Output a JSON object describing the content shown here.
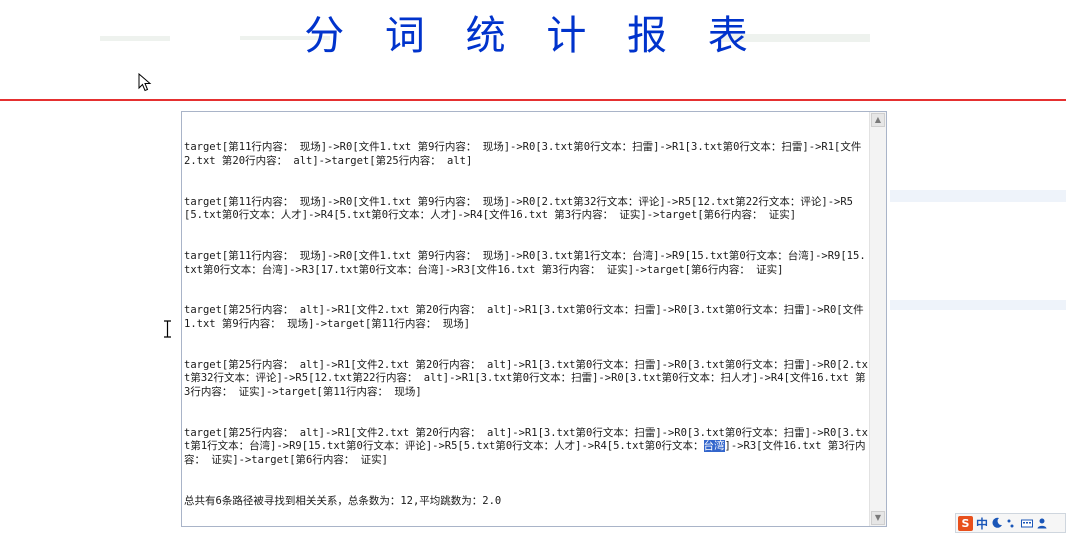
{
  "page": {
    "title": "分 词 统 计 报 表"
  },
  "colors": {
    "title": "#0033cc",
    "divider": "#e53030",
    "textarea_border": "#a9b4c8",
    "selection": "#3366cc"
  },
  "report": {
    "lines": [
      "target[第11行内容： 现场]->R0[文件1.txt 第9行内容： 现场]->R0[3.txt第0行文本：扫雷]->R1[3.txt第0行文本：扫雷]->R1[文件2.txt 第20行内容： alt]->target[第25行内容： alt]",
      "target[第11行内容： 现场]->R0[文件1.txt 第9行内容： 现场]->R0[2.txt第32行文本：评论]->R5[12.txt第22行文本：评论]->R5[5.txt第0行文本：人才]->R4[5.txt第0行文本：人才]->R4[文件16.txt 第3行内容： 证实]->target[第6行内容： 证实]",
      "target[第11行内容： 现场]->R0[文件1.txt 第9行内容： 现场]->R0[3.txt第1行文本：台湾]->R9[15.txt第0行文本：台湾]->R9[15.txt第0行文本：台湾]->R3[17.txt第0行文本：台湾]->R3[文件16.txt 第3行内容： 证实]->target[第6行内容： 证实]",
      "target[第25行内容： alt]->R1[文件2.txt 第20行内容： alt]->R1[3.txt第0行文本：扫雷]->R0[3.txt第0行文本：扫雷]->R0[文件1.txt 第9行内容： 现场]->target[第11行内容： 现场]",
      "target[第25行内容： alt]->R1[文件2.txt 第20行内容： alt]->R1[3.txt第0行文本：扫雷]->R0[3.txt第0行文本：扫雷]->R0[2.txt第32行文本：评论]->R5[12.txt第22行内容： alt]->R1[3.txt第0行文本：扫雷]->R0[3.txt第0行文本：扫人才]->R4[文件16.txt 第3行内容： 证实]->target[第11行内容： 现场]",
      "target[第25行内容： alt]->R1[文件2.txt 第20行内容： alt]->R1[3.txt第0行文本：扫雷]->R0[3.txt第0行文本：扫雷]->R0[3.txt第1行文本：台湾]->R9[15.txt第0行文本：评论]->R5[5.txt第0行文本：人才]->R4[5.txt第0行文本："
    ],
    "selected_word": "台湾",
    "last_line_tail": "]->R3[文件16.txt 第3行内容： 证实]->target[第6行内容： 证实]",
    "summary": "总共有6条路径被寻找到相关关系，总条数为：12,平均跳数为：2.0"
  },
  "ime": {
    "logo": "S",
    "mode": "中"
  },
  "icons": {
    "cursor": "mouse-pointer-icon",
    "text_cursor": "text-cursor-icon",
    "scroll_up": "scroll-up-icon",
    "scroll_down": "scroll-down-icon"
  }
}
